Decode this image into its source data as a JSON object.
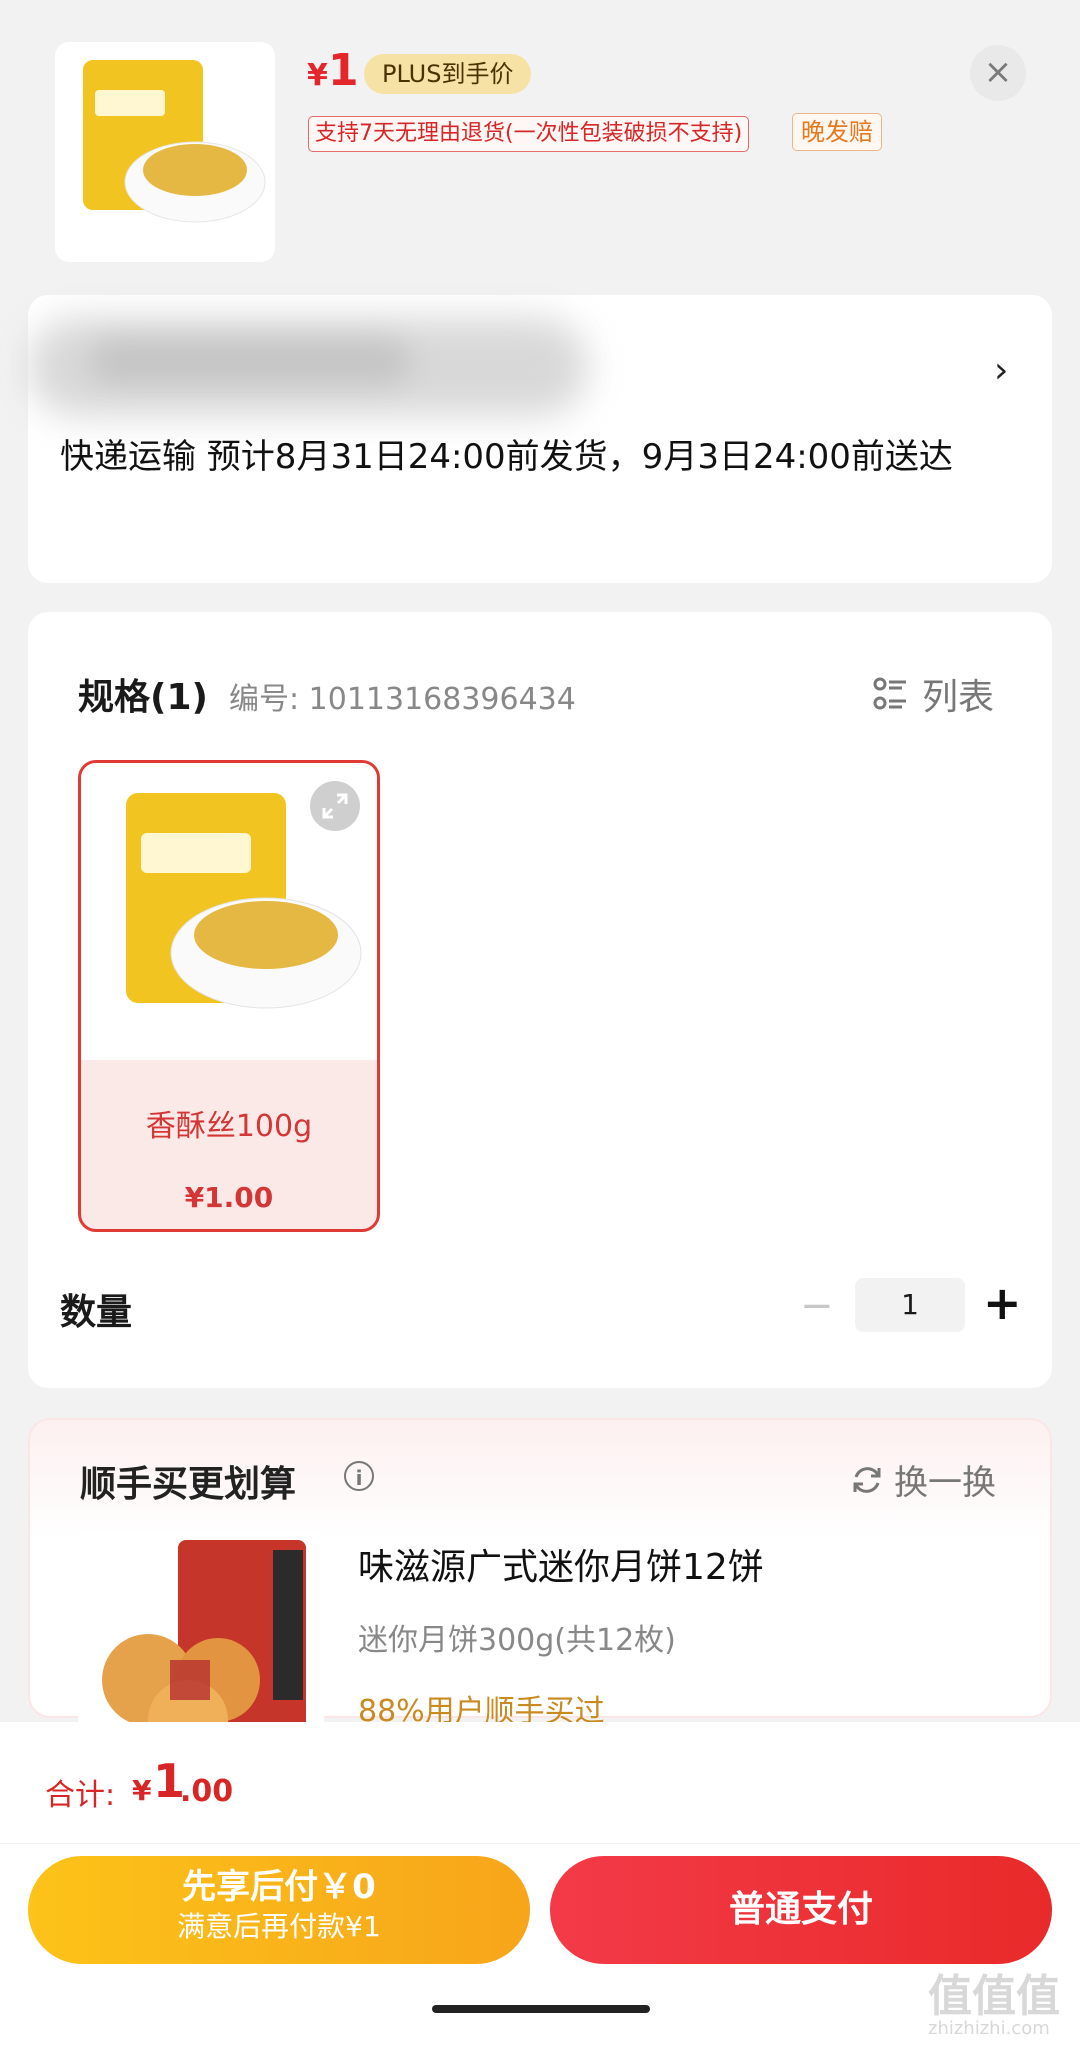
{
  "header": {
    "price_symbol": "¥",
    "price_value": "1",
    "plus_badge": "PLUS到手价",
    "return_policy": "支持7天无理由退货(一次性包装破损不支持)",
    "late_comp": "晚发赔",
    "close_icon": "close-icon"
  },
  "address": {
    "delivery_text": "快递运输 预计8月31日24:00前发货，9月3日24:00前送达",
    "chevron": "›"
  },
  "spec": {
    "title": "规格(1)",
    "code": "编号: 10113168396434",
    "list_toggle": "列表",
    "item": {
      "name": "香酥丝100g",
      "price": "¥1.00"
    },
    "quantity_label": "数量",
    "quantity": "1",
    "minus": "−",
    "plus": "+"
  },
  "upsell": {
    "title": "顺手买更划算",
    "swap": "换一换",
    "product_name": "味滋源广式迷你月饼12饼",
    "product_spec": "迷你月饼300g(共12枚)",
    "bought_ratio": "88%用户顺手买过"
  },
  "footer": {
    "total_label": "合计:",
    "total_symbol": "¥",
    "total_int": "1",
    "total_dec": ".00",
    "pay_later_line1": "先享后付￥0",
    "pay_later_line2": "满意后再付款¥1",
    "pay_normal": "普通支付"
  },
  "watermark": {
    "main": "值值值",
    "sub": "zhizhizhi.com"
  },
  "colors": {
    "accent_red": "#e4262b",
    "accent_yellow": "#fcc319",
    "badge_gold": "#f7e2a6"
  }
}
